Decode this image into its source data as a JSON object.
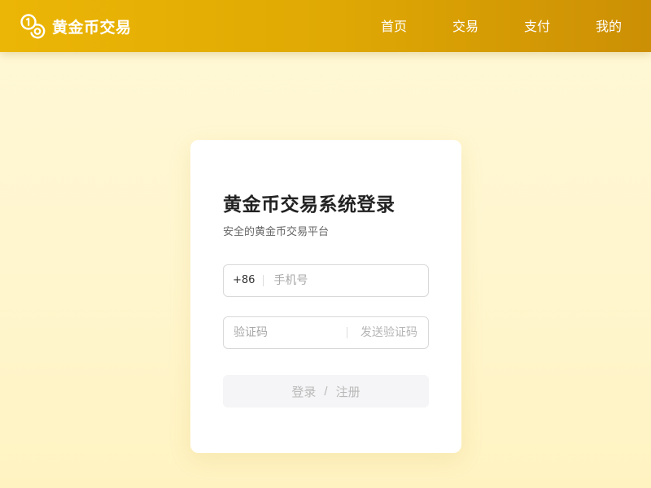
{
  "header": {
    "brand": "黄金币交易",
    "logo_icon": "coins-icon",
    "nav": [
      {
        "label": "首页"
      },
      {
        "label": "交易"
      },
      {
        "label": "支付"
      },
      {
        "label": "我的"
      }
    ]
  },
  "login": {
    "title": "黄金币交易系统登录",
    "subtitle": "安全的黄金币交易平台",
    "phone": {
      "prefix": "+86",
      "placeholder": "手机号",
      "value": ""
    },
    "code": {
      "placeholder": "验证码",
      "value": "",
      "send_label": "发送验证码"
    },
    "submit": {
      "login_label": "登录",
      "separator": "/",
      "register_label": "注册"
    }
  },
  "colors": {
    "brand_gold": "#e0a904",
    "page_bg": "#fff6cf",
    "button_disabled_bg": "#f5f5f7"
  }
}
